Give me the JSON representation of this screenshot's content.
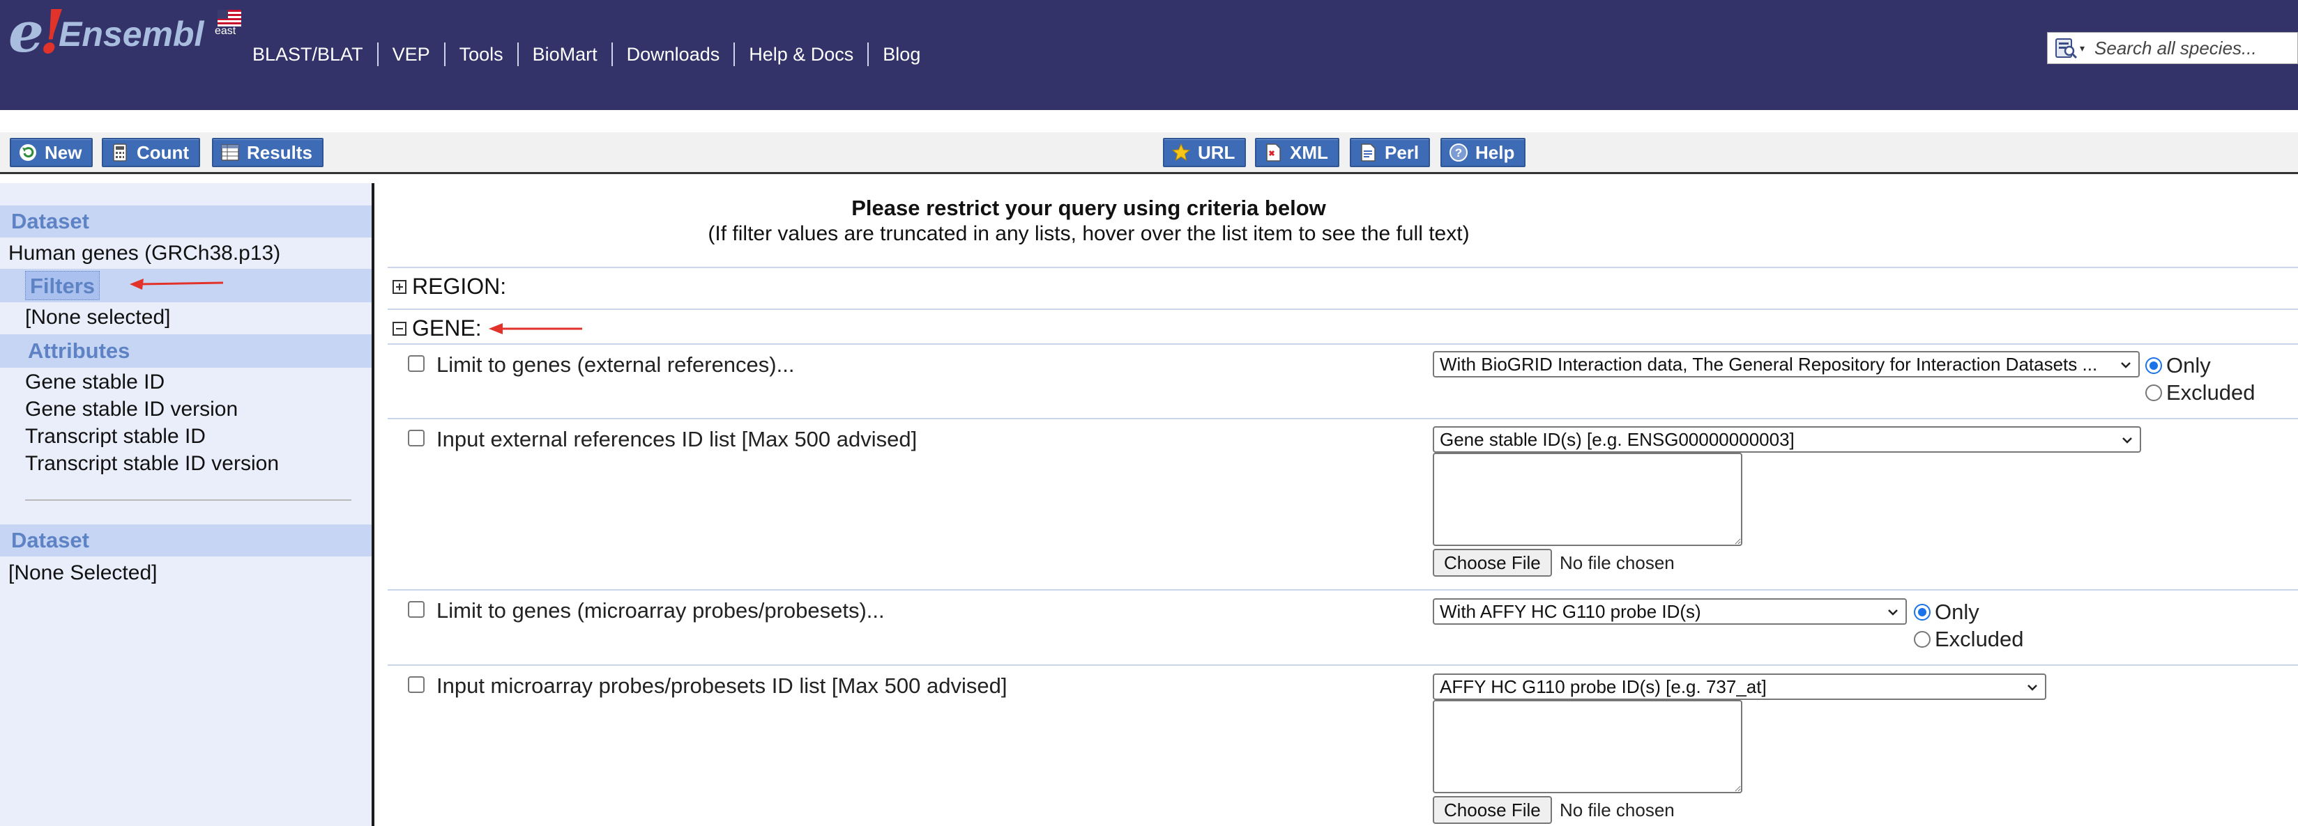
{
  "masthead": {
    "logo_text": "Ensembl",
    "flag_label": "east",
    "nav": [
      "BLAST/BLAT",
      "VEP",
      "Tools",
      "BioMart",
      "Downloads",
      "Help & Docs",
      "Blog"
    ],
    "search_placeholder": "Search all species..."
  },
  "toolbar": {
    "new_label": "New",
    "count_label": "Count",
    "results_label": "Results",
    "url_label": "URL",
    "xml_label": "XML",
    "perl_label": "Perl",
    "help_label": "Help"
  },
  "left_panel": {
    "dataset1_heading": "Dataset",
    "dataset1_value": "Human genes (GRCh38.p13)",
    "filters_label": "Filters",
    "filters_value": "[None selected]",
    "attributes_heading": "Attributes",
    "attributes": [
      "Gene stable ID",
      "Gene stable ID version",
      "Transcript stable ID",
      "Transcript stable ID version"
    ],
    "dataset2_heading": "Dataset",
    "dataset2_value": "[None Selected]"
  },
  "main": {
    "title": "Please restrict your query using criteria below",
    "subtitle": "(If filter values are truncated in any lists, hover over the list item to see the full text)",
    "region_label": "REGION:",
    "gene_label": "GENE:",
    "rows": [
      {
        "label": "Limit to genes (external references)...",
        "select": "With BioGRID Interaction data, The General Repository for Interaction Datasets ...",
        "only": "Only",
        "excluded": "Excluded"
      },
      {
        "label": "Input external references ID list [Max 500 advised]",
        "select": "Gene stable ID(s) [e.g. ENSG00000000003]",
        "file_button": "Choose File",
        "file_status": "No file chosen"
      },
      {
        "label": "Limit to genes (microarray probes/probesets)...",
        "select": "With AFFY HC G110 probe ID(s)",
        "only": "Only",
        "excluded": "Excluded"
      },
      {
        "label": "Input microarray probes/probesets ID list [Max 500 advised]",
        "select": "AFFY HC G110 probe ID(s) [e.g. 737_at]",
        "file_button": "Choose File",
        "file_status": "No file chosen"
      }
    ]
  },
  "colors": {
    "masthead": "#33336a",
    "button": "#3d6bb5",
    "panel_bg": "#eaeefb",
    "panel_heading": "#c7d5f5",
    "annotation_arrow": "#e2332b"
  }
}
